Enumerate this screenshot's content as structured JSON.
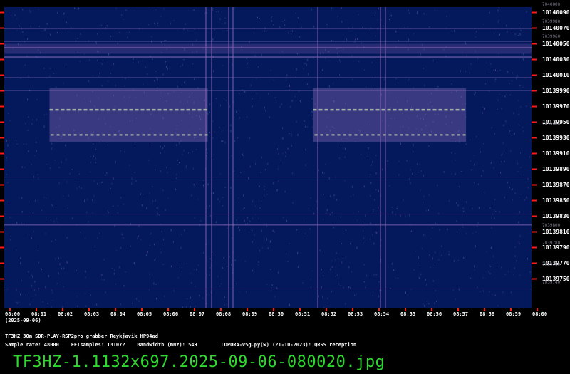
{
  "colors": {
    "background": "#04195c",
    "signal": "#8a68b8",
    "carrier": "#b0c0a8",
    "tick_red": "#ff1a1a",
    "frame": "#000000",
    "filename_green": "#2fd82f"
  },
  "chart_data": {
    "type": "heatmap",
    "xlabel": "",
    "ylabel": "",
    "time_ticks": [
      "08:00",
      "08:01",
      "08:02",
      "08:03",
      "08:04",
      "08:05",
      "08:06",
      "08:07",
      "08:08",
      "08:09",
      "08:50",
      "08:51",
      "08:52",
      "08:53",
      "08:54",
      "08:55",
      "08:56",
      "08:57",
      "08:58",
      "08:59",
      "08:00"
    ],
    "date": "(2025-09-06)",
    "frequency_ticks": [
      "10140090",
      "10140070",
      "10140050",
      "10140030",
      "10140010",
      "10139990",
      "10139970",
      "10139950",
      "10139930",
      "10139910",
      "10139890",
      "10139870",
      "10139850",
      "10139830",
      "10139810",
      "10139790",
      "10139770",
      "10139750"
    ],
    "ghost_ticks": [
      "7040000",
      "7039980",
      "7039960",
      "7039860",
      "7039800",
      "7039780",
      "7039760",
      "7039740"
    ],
    "ylim": [
      10139750,
      10140100
    ],
    "qrss_segments": [
      {
        "t_start_min": 1.5,
        "t_end_min": 7.5,
        "upper_tone_hz": 10139966,
        "lower_tone_hz": 10139934
      },
      {
        "t_start_min": 11.5,
        "t_end_min": 17.3,
        "upper_tone_hz": 10139966,
        "lower_tone_hz": 10139934
      }
    ],
    "persistent_lines_hz": [
      10140034,
      10140046,
      10139820
    ],
    "grid": false
  },
  "info": {
    "line1": "TF3HZ 30m SDR-PLAY-RSP2pro grabber Reykjavik HP94ad",
    "line2": "Sample rate: 48000    FFTsamples: 131072    Bandwidth (mHz): 549        LOPORA-v5g.py(w) (21-10-2023): QRSS reception"
  },
  "filename": "TF3HZ-1.1132x697.2025-09-06-080020.jpg"
}
